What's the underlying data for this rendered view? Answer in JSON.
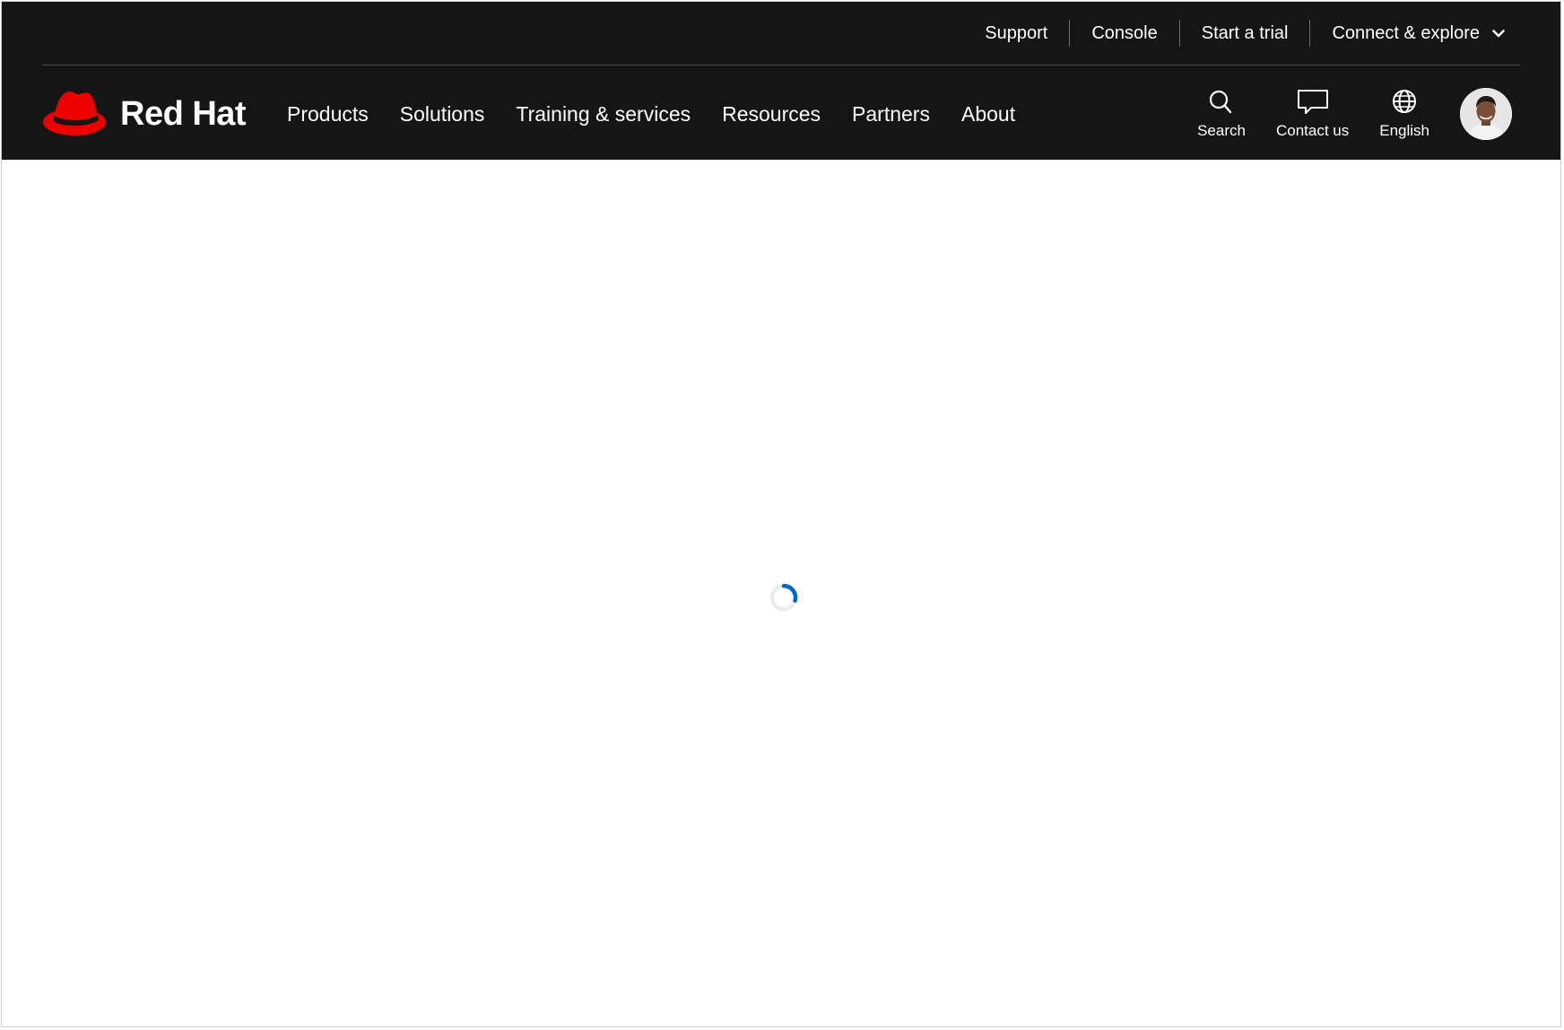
{
  "utility_nav": {
    "support": "Support",
    "console": "Console",
    "start_trial": "Start a trial",
    "connect_explore": "Connect & explore"
  },
  "logo": {
    "text": "Red Hat"
  },
  "primary_nav": {
    "items": [
      "Products",
      "Solutions",
      "Training & services",
      "Resources",
      "Partners",
      "About"
    ]
  },
  "tools": {
    "search": "Search",
    "contact": "Contact us",
    "language": "English"
  },
  "colors": {
    "masthead_bg": "#151515",
    "brand_red": "#ee0000",
    "spinner_accent": "#0066cc",
    "spinner_track": "#ececec"
  },
  "icons": {
    "logo": "red-hat-fedora-icon",
    "chevron": "chevron-down-icon",
    "search": "search-icon",
    "contact": "chat-bubble-icon",
    "language": "globe-icon",
    "loading": "loading-spinner-icon"
  }
}
